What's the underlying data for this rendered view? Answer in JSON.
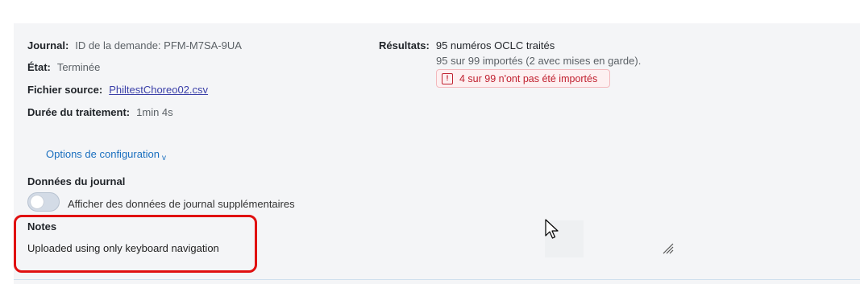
{
  "details": {
    "journal_label": "Journal:",
    "journal_value": "ID de la demande: PFM-M7SA-9UA",
    "etat_label": "État:",
    "etat_value": "Terminée",
    "fichier_label": "Fichier source:",
    "fichier_value": "PhiltestChoreo02.csv",
    "duree_label": "Durée du traitement:",
    "duree_value": "1min 4s"
  },
  "results": {
    "label": "Résultats:",
    "line1": "95 numéros OCLC traités",
    "line2": "95 sur 99 importés (2 avec mises en garde).",
    "warning": "4 sur 99 n'ont pas été importés",
    "warning_icon": "!"
  },
  "config": {
    "label": "Options de configuration",
    "chevron": "v"
  },
  "journal_data": {
    "title": "Données du journal",
    "toggle_label": "Afficher des données de journal supplémentaires",
    "toggle_on": false
  },
  "notes": {
    "title": "Notes",
    "text": "Uploaded using only keyboard navigation"
  },
  "colors": {
    "highlight": "#e01010",
    "warning": "#c0202f",
    "link": "#1a6fbf"
  }
}
